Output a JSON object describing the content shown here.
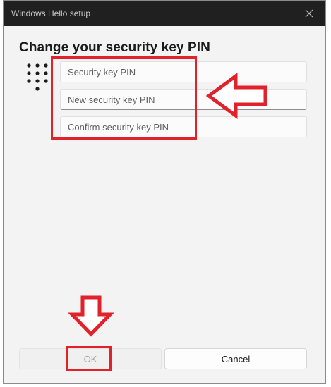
{
  "window": {
    "title": "Windows Hello setup"
  },
  "heading": "Change your security key PIN",
  "icons": {
    "close": "close-icon",
    "keypad": "keypad-icon",
    "arrow_left": "red-arrow-left-icon",
    "arrow_down": "red-arrow-down-icon"
  },
  "fields": [
    {
      "placeholder": "Security key PIN",
      "value": ""
    },
    {
      "placeholder": "New security key PIN",
      "value": ""
    },
    {
      "placeholder": "Confirm security key PIN",
      "value": ""
    }
  ],
  "buttons": {
    "ok": {
      "label": "OK",
      "enabled": false
    },
    "cancel": {
      "label": "Cancel",
      "enabled": true
    }
  },
  "colors": {
    "titlebar": "#202020",
    "dialog_bg": "#f3f3f3",
    "annotation_red": "#e1222b"
  }
}
